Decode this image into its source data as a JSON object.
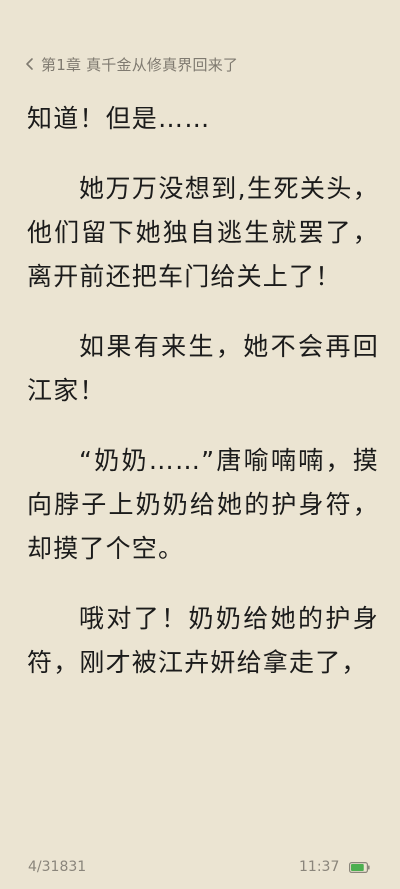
{
  "header": {
    "chapter_title": "第1章 真千金从修真界回来了",
    "back_icon": "chevron-left-icon"
  },
  "content": {
    "paragraphs": [
      "知道！但是……",
      "她万万没想到,生死关头，他们留下她独自逃生就罢了，离开前还把车门给关上了！",
      "如果有来生，她不会再回江家！",
      "“奶奶……”唐喻喃喃，摸向脖子上奶奶给她的护身符，却摸了个空。",
      "哦对了！奶奶给她的护身符，刚才被江卉妍给拿走了，"
    ]
  },
  "footer": {
    "page_indicator": "4/31831",
    "time": "11:37",
    "battery_icon": "battery-icon",
    "battery_level": 0.85,
    "battery_color": "#4caf50"
  },
  "colors": {
    "background": "#ebe4d2",
    "text": "#1b1b1b",
    "muted": "#8a857b"
  }
}
